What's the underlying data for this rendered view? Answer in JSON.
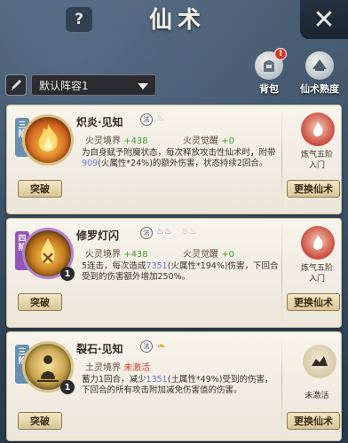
{
  "header": {
    "help_glyph": "?",
    "title": "仙术",
    "close_glyph": "✕"
  },
  "top_icons": [
    {
      "label": "背包",
      "icon": "backpack-icon",
      "badge": "!"
    },
    {
      "label": "仙术熟度",
      "icon": "scroll-icon"
    }
  ],
  "lineup": {
    "selected": "默认阵容1"
  },
  "cards": [
    {
      "tier": "三阶",
      "name": "炽炎·见知",
      "tag": "法",
      "icon_color": "#d2691e",
      "realm_label": "火灵境界",
      "realm_value": "+438",
      "awaken_label": "火灵觉醒",
      "awaken_value": "+0",
      "desc_pre": "为自身赋予附魔状态，每次释放攻击性仙术时，附带",
      "desc_num": "909",
      "desc_post": "(火属性*24%)的额外伤害，状态持续2回合。",
      "breakthrough": "突破",
      "right_label": "炼气五阶\n入门",
      "replace": "更换仙术"
    },
    {
      "tier": "四阶",
      "name": "修罗灯闪",
      "tag": "法",
      "count": "1",
      "realm_label": "火灵境界",
      "realm_value": "+438",
      "awaken_label": "火灵觉醒",
      "awaken_value": "+0",
      "desc_pre": "5连击，每次造成",
      "desc_num": "7351",
      "desc_post": "(火属性*194%)伤害，下回合受到的伤害额外增加250%。",
      "breakthrough": "突破",
      "right_label": "炼气五阶\n入门",
      "replace": "更换仙术"
    },
    {
      "tier": "三阶",
      "name": "裂石·见知",
      "tag": "法",
      "count": "1",
      "realm_label": "土灵境界",
      "realm_value": "未激活",
      "desc_pre": "蓄力1回合，减少",
      "desc_num": "1351",
      "desc_post": "(土属性*49%)受到的伤害，下回合的所有攻击附加减免伤害值的伤害。",
      "breakthrough": "突破",
      "right_label": "未激活",
      "replace": "更换仙术"
    }
  ]
}
